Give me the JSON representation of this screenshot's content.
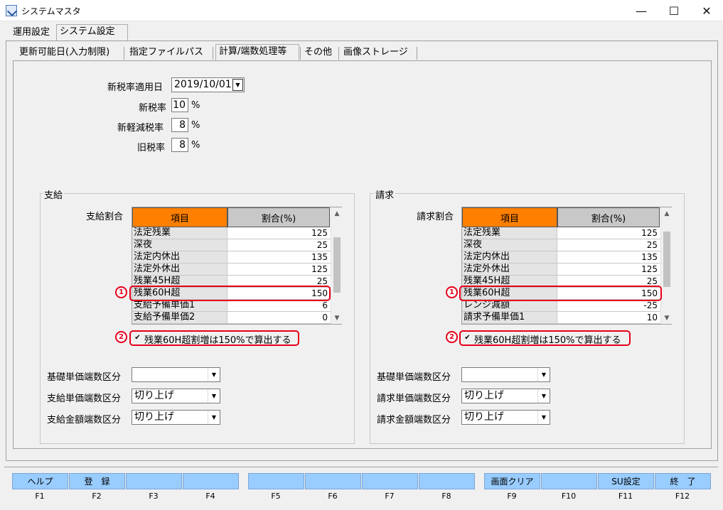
{
  "window": {
    "title": "システムマスタ",
    "minimize": "—",
    "maximize": "☐",
    "close": "✕"
  },
  "main_tabs": [
    "運用設定",
    "システム設定"
  ],
  "sub_tabs": [
    "更新可能日(入力制限)",
    "指定ファイルパス",
    "計算/端数処理等",
    "その他",
    "画像ストレージ"
  ],
  "tax": {
    "new_rate_date_label": "新税率適用日",
    "new_rate_date_value": "2019/10/01",
    "new_rate_label": "新税率",
    "new_rate_value": "10",
    "new_reduced_label": "新軽減税率",
    "new_reduced_value": "8",
    "old_rate_label": "旧税率",
    "old_rate_value": "8",
    "percent": "%"
  },
  "pay": {
    "group_title": "支給",
    "ratio_label": "支給割合",
    "col_item": "項目",
    "col_ratio": "割合(%)",
    "rows": [
      {
        "item": "法定残業",
        "ratio": "125"
      },
      {
        "item": "深夜",
        "ratio": "25"
      },
      {
        "item": "法定内休出",
        "ratio": "135"
      },
      {
        "item": "法定外休出",
        "ratio": "125"
      },
      {
        "item": "残業45H超",
        "ratio": "25"
      },
      {
        "item": "残業60H超",
        "ratio": "150"
      },
      {
        "item": "支給予備単価1",
        "ratio": "6"
      },
      {
        "item": "支給予備単価2",
        "ratio": "0"
      }
    ],
    "checkbox_label": "残業60H超割増は150%で算出する",
    "checkbox_mark": "✔",
    "rounding": [
      {
        "label": "基礎単価端数区分",
        "value": ""
      },
      {
        "label": "支給単価端数区分",
        "value": "切り上げ"
      },
      {
        "label": "支給金額端数区分",
        "value": "切り上げ"
      }
    ]
  },
  "bill": {
    "group_title": "請求",
    "ratio_label": "請求割合",
    "col_item": "項目",
    "col_ratio": "割合(%)",
    "rows": [
      {
        "item": "法定残業",
        "ratio": "125"
      },
      {
        "item": "深夜",
        "ratio": "25"
      },
      {
        "item": "法定内休出",
        "ratio": "135"
      },
      {
        "item": "法定外休出",
        "ratio": "125"
      },
      {
        "item": "残業45H超",
        "ratio": "25"
      },
      {
        "item": "残業60H超",
        "ratio": "150"
      },
      {
        "item": "レンジ減額",
        "ratio": "-25"
      },
      {
        "item": "請求予備単価1",
        "ratio": "10"
      }
    ],
    "checkbox_label": "残業60H超割増は150%で算出する",
    "checkbox_mark": "✔",
    "rounding": [
      {
        "label": "基礎単価端数区分",
        "value": ""
      },
      {
        "label": "請求単価端数区分",
        "value": "切り上げ"
      },
      {
        "label": "請求金額端数区分",
        "value": "切り上げ"
      }
    ]
  },
  "markers": {
    "one": "1",
    "two": "2"
  },
  "fkeys": [
    {
      "label": "ヘルプ",
      "key": "F1"
    },
    {
      "label": "登　録",
      "key": "F2"
    },
    {
      "label": "",
      "key": "F3"
    },
    {
      "label": "",
      "key": "F4"
    },
    {
      "label": "",
      "key": "F5"
    },
    {
      "label": "",
      "key": "F6"
    },
    {
      "label": "",
      "key": "F7"
    },
    {
      "label": "",
      "key": "F8"
    },
    {
      "label": "画面クリア",
      "key": "F9"
    },
    {
      "label": "",
      "key": "F10"
    },
    {
      "label": "SU設定",
      "key": "F11"
    },
    {
      "label": "終　了",
      "key": "F12"
    }
  ],
  "colors": {
    "header_item": "#ff7f00",
    "header_ratio": "#c8c8c8",
    "fkey": "#99ccff",
    "highlight": "#e6001a"
  }
}
